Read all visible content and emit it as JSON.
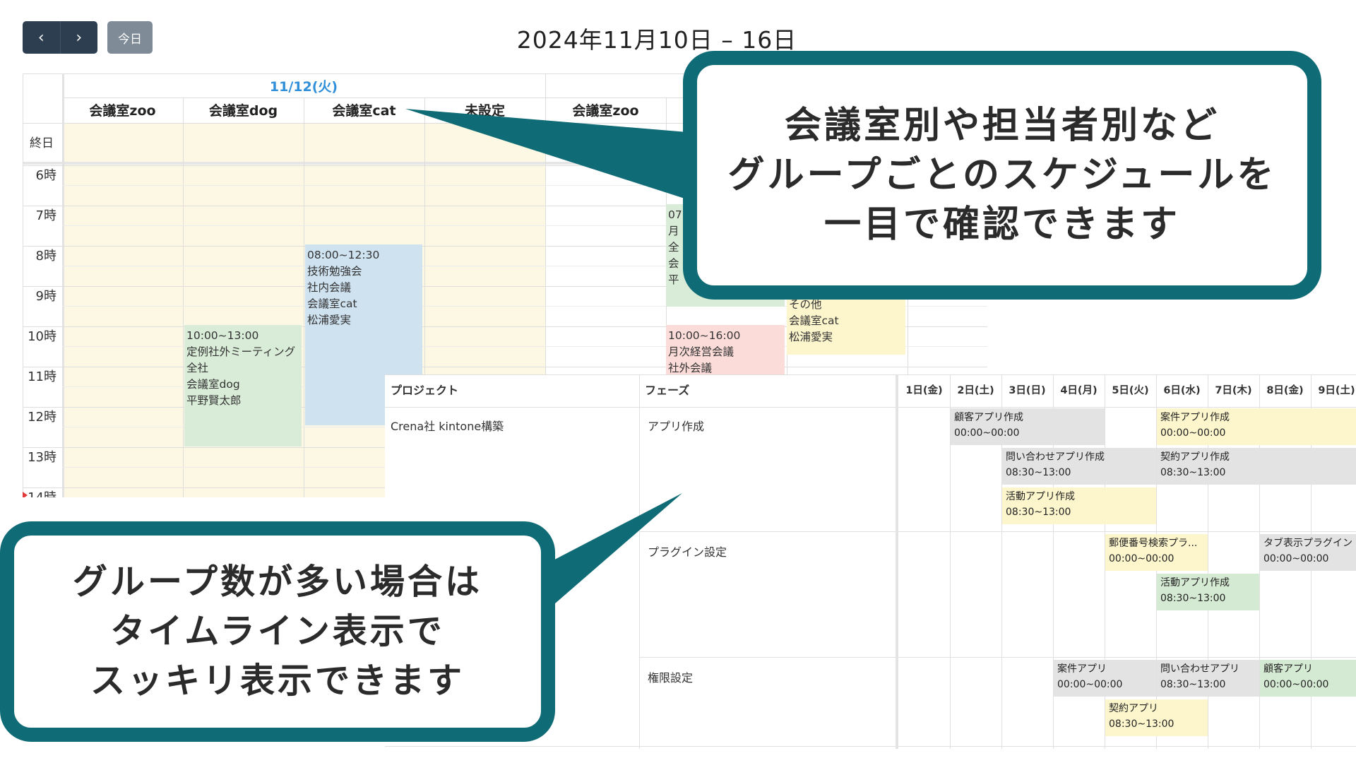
{
  "toolbar": {
    "prev_icon": "‹",
    "next_icon": "›",
    "today_label": "今日",
    "title": "2024年11月10日 – 16日"
  },
  "calendar": {
    "date_header": "11/12(火)",
    "resources": [
      "会議室zoo",
      "会議室dog",
      "会議室cat",
      "未設定",
      "会議室zoo"
    ],
    "allday_label": "終日",
    "hours": [
      "6時",
      "7時",
      "8時",
      "9時",
      "10時",
      "11時",
      "12時",
      "13時",
      "14時"
    ],
    "events": [
      {
        "lines": [
          "08:00~12:30",
          "技術勉強会",
          "社内会議",
          "会議室cat",
          "松浦愛実"
        ],
        "color": "#cfe2f0"
      },
      {
        "lines": [
          "10:00~13:00",
          "定例社外ミーティング",
          "全社",
          "会議室dog",
          "平野賢太郎"
        ],
        "color": "#d9ecd8"
      },
      {
        "lines": [
          "07",
          "月",
          "全",
          "会",
          "平"
        ],
        "color": "#d9ecd8"
      },
      {
        "lines": [
          "10:00~16:00",
          "月次経営会議",
          "社外会議"
        ],
        "color": "#fbdcd8"
      },
      {
        "lines": [
          "その他",
          "会議室cat",
          "松浦愛実"
        ],
        "color": "#fdf6cd"
      }
    ]
  },
  "timeline": {
    "headers": {
      "project": "プロジェクト",
      "phase": "フェーズ"
    },
    "days": [
      "1日(金)",
      "2日(土)",
      "3日(日)",
      "4日(月)",
      "5日(火)",
      "6日(水)",
      "7日(木)",
      "8日(金)",
      "9日(土)"
    ],
    "project_name": "Crena社 kintone構築",
    "phases": [
      "アプリ作成",
      "プラグイン設定",
      "権限設定"
    ],
    "bars": [
      {
        "title": "顧客アプリ作成",
        "time": "00:00~00:00",
        "color": "gray"
      },
      {
        "title": "案件アプリ作成",
        "time": "00:00~00:00",
        "color": "yellow"
      },
      {
        "title": "問い合わせアプリ作成",
        "time": "08:30~13:00",
        "color": "gray"
      },
      {
        "title": "契約アプリ作成",
        "time": "08:30~13:00",
        "color": "gray"
      },
      {
        "title": "活動アプリ作成",
        "time": "08:30~13:00",
        "color": "yellow"
      },
      {
        "title": "郵便番号検索プラ...",
        "time": "00:00~00:00",
        "color": "yellow"
      },
      {
        "title": "タブ表示プラグイン",
        "time": "00:00~00:00",
        "color": "gray"
      },
      {
        "title": "活動アプリ作成",
        "time": "08:30~13:00",
        "color": "green"
      },
      {
        "title": "案件アプリ",
        "time": "00:00~00:00",
        "color": "gray"
      },
      {
        "title": "問い合わせアプリ",
        "time": "08:30~13:00",
        "color": "gray"
      },
      {
        "title": "顧客アプリ",
        "time": "00:00~00:00",
        "color": "green"
      },
      {
        "title": "契約アプリ",
        "time": "08:30~13:00",
        "color": "yellow"
      }
    ]
  },
  "callouts": {
    "top": [
      "会議室別や担当者別など",
      "グループごとのスケジュールを",
      "一目で確認できます"
    ],
    "bottom": [
      "グループ数が多い場合は",
      "タイムライン表示で",
      "スッキリ表示できます"
    ],
    "accent_color": "#0f6b75"
  }
}
